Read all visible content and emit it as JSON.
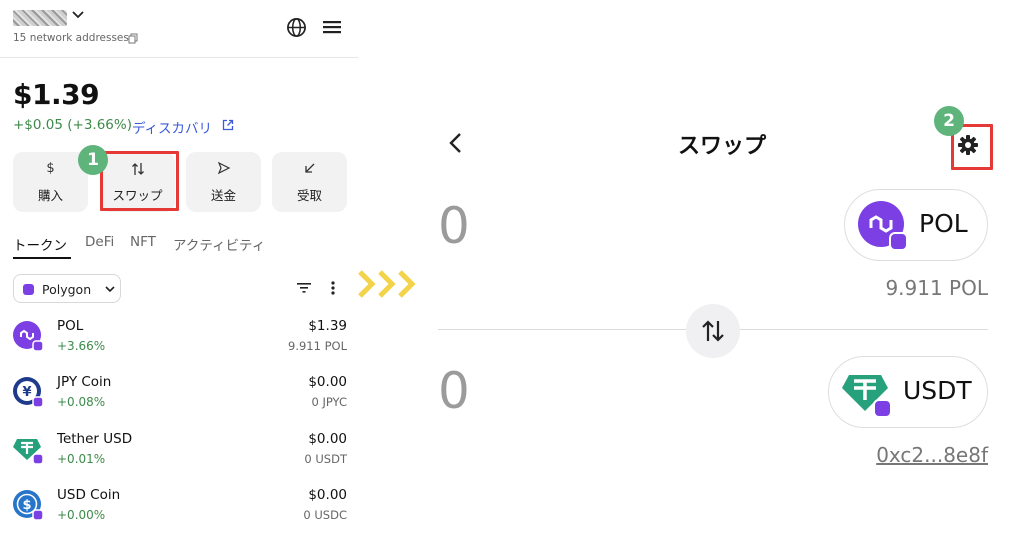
{
  "left": {
    "network_addresses": "15 network addresses",
    "balance": "$1.39",
    "change": "+$0.05 (+3.66%)",
    "discover": "ディスカバリ",
    "actions": [
      {
        "label": "購入",
        "icon": "dollar-icon"
      },
      {
        "label": "スワップ",
        "icon": "swap-arrows-icon"
      },
      {
        "label": "送金",
        "icon": "send-icon"
      },
      {
        "label": "受取",
        "icon": "receive-icon"
      }
    ],
    "badge": "1",
    "tabs": [
      "トークン",
      "DeFi",
      "NFT",
      "アクティビティ"
    ],
    "network": "Polygon",
    "tokens": [
      {
        "name": "POL",
        "pct": "+3.66%",
        "usd": "$1.39",
        "amount": "9.911 POL",
        "icon": "pol-logo",
        "color": "#7b3fe4"
      },
      {
        "name": "JPY Coin",
        "pct": "+0.08%",
        "usd": "$0.00",
        "amount": "0 JPYC",
        "icon": "jpyc-logo",
        "color": "#1e3a8a"
      },
      {
        "name": "Tether USD",
        "pct": "+0.01%",
        "usd": "$0.00",
        "amount": "0 USDT",
        "icon": "usdt-logo",
        "color": "#26a17b"
      },
      {
        "name": "USD Coin",
        "pct": "+0.00%",
        "usd": "$0.00",
        "amount": "0 USDC",
        "icon": "usdc-logo",
        "color": "#2775ca"
      }
    ]
  },
  "right": {
    "title": "スワップ",
    "badge": "2",
    "from": {
      "amount": "0",
      "symbol": "POL",
      "balance": "9.911 POL"
    },
    "to": {
      "amount": "0",
      "symbol": "USDT",
      "address": "0xc2...8e8f"
    }
  },
  "colors": {
    "accent_green": "#5fb47c",
    "highlight_red": "#e53935",
    "polygon_purple": "#7b3fe4",
    "tether_green": "#26a17b",
    "arrow_yellow": "#f3d34a"
  }
}
